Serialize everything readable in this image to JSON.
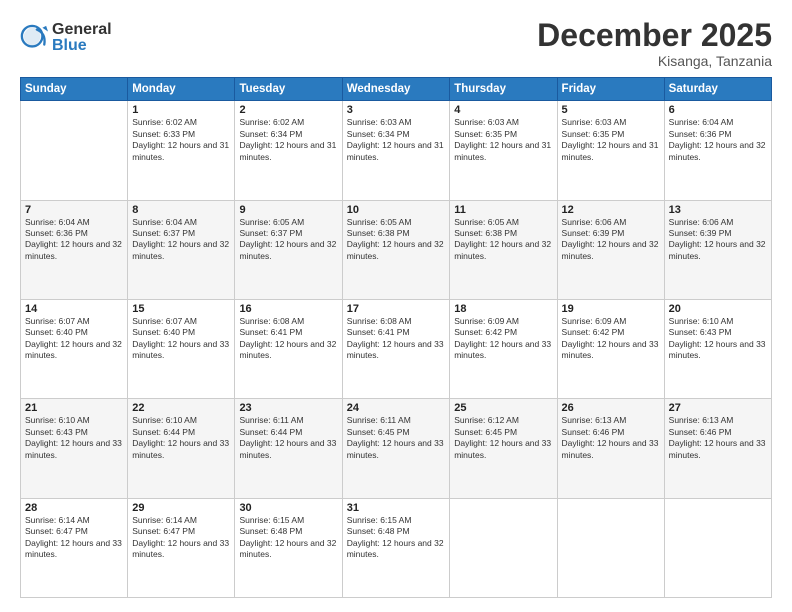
{
  "logo": {
    "general": "General",
    "blue": "Blue"
  },
  "header": {
    "month": "December 2025",
    "location": "Kisanga, Tanzania"
  },
  "days_of_week": [
    "Sunday",
    "Monday",
    "Tuesday",
    "Wednesday",
    "Thursday",
    "Friday",
    "Saturday"
  ],
  "weeks": [
    [
      {
        "day": "",
        "sunrise": "",
        "sunset": "",
        "daylight": ""
      },
      {
        "day": "1",
        "sunrise": "Sunrise: 6:02 AM",
        "sunset": "Sunset: 6:33 PM",
        "daylight": "Daylight: 12 hours and 31 minutes."
      },
      {
        "day": "2",
        "sunrise": "Sunrise: 6:02 AM",
        "sunset": "Sunset: 6:34 PM",
        "daylight": "Daylight: 12 hours and 31 minutes."
      },
      {
        "day": "3",
        "sunrise": "Sunrise: 6:03 AM",
        "sunset": "Sunset: 6:34 PM",
        "daylight": "Daylight: 12 hours and 31 minutes."
      },
      {
        "day": "4",
        "sunrise": "Sunrise: 6:03 AM",
        "sunset": "Sunset: 6:35 PM",
        "daylight": "Daylight: 12 hours and 31 minutes."
      },
      {
        "day": "5",
        "sunrise": "Sunrise: 6:03 AM",
        "sunset": "Sunset: 6:35 PM",
        "daylight": "Daylight: 12 hours and 31 minutes."
      },
      {
        "day": "6",
        "sunrise": "Sunrise: 6:04 AM",
        "sunset": "Sunset: 6:36 PM",
        "daylight": "Daylight: 12 hours and 32 minutes."
      }
    ],
    [
      {
        "day": "7",
        "sunrise": "Sunrise: 6:04 AM",
        "sunset": "Sunset: 6:36 PM",
        "daylight": "Daylight: 12 hours and 32 minutes."
      },
      {
        "day": "8",
        "sunrise": "Sunrise: 6:04 AM",
        "sunset": "Sunset: 6:37 PM",
        "daylight": "Daylight: 12 hours and 32 minutes."
      },
      {
        "day": "9",
        "sunrise": "Sunrise: 6:05 AM",
        "sunset": "Sunset: 6:37 PM",
        "daylight": "Daylight: 12 hours and 32 minutes."
      },
      {
        "day": "10",
        "sunrise": "Sunrise: 6:05 AM",
        "sunset": "Sunset: 6:38 PM",
        "daylight": "Daylight: 12 hours and 32 minutes."
      },
      {
        "day": "11",
        "sunrise": "Sunrise: 6:05 AM",
        "sunset": "Sunset: 6:38 PM",
        "daylight": "Daylight: 12 hours and 32 minutes."
      },
      {
        "day": "12",
        "sunrise": "Sunrise: 6:06 AM",
        "sunset": "Sunset: 6:39 PM",
        "daylight": "Daylight: 12 hours and 32 minutes."
      },
      {
        "day": "13",
        "sunrise": "Sunrise: 6:06 AM",
        "sunset": "Sunset: 6:39 PM",
        "daylight": "Daylight: 12 hours and 32 minutes."
      }
    ],
    [
      {
        "day": "14",
        "sunrise": "Sunrise: 6:07 AM",
        "sunset": "Sunset: 6:40 PM",
        "daylight": "Daylight: 12 hours and 32 minutes."
      },
      {
        "day": "15",
        "sunrise": "Sunrise: 6:07 AM",
        "sunset": "Sunset: 6:40 PM",
        "daylight": "Daylight: 12 hours and 33 minutes."
      },
      {
        "day": "16",
        "sunrise": "Sunrise: 6:08 AM",
        "sunset": "Sunset: 6:41 PM",
        "daylight": "Daylight: 12 hours and 32 minutes."
      },
      {
        "day": "17",
        "sunrise": "Sunrise: 6:08 AM",
        "sunset": "Sunset: 6:41 PM",
        "daylight": "Daylight: 12 hours and 33 minutes."
      },
      {
        "day": "18",
        "sunrise": "Sunrise: 6:09 AM",
        "sunset": "Sunset: 6:42 PM",
        "daylight": "Daylight: 12 hours and 33 minutes."
      },
      {
        "day": "19",
        "sunrise": "Sunrise: 6:09 AM",
        "sunset": "Sunset: 6:42 PM",
        "daylight": "Daylight: 12 hours and 33 minutes."
      },
      {
        "day": "20",
        "sunrise": "Sunrise: 6:10 AM",
        "sunset": "Sunset: 6:43 PM",
        "daylight": "Daylight: 12 hours and 33 minutes."
      }
    ],
    [
      {
        "day": "21",
        "sunrise": "Sunrise: 6:10 AM",
        "sunset": "Sunset: 6:43 PM",
        "daylight": "Daylight: 12 hours and 33 minutes."
      },
      {
        "day": "22",
        "sunrise": "Sunrise: 6:10 AM",
        "sunset": "Sunset: 6:44 PM",
        "daylight": "Daylight: 12 hours and 33 minutes."
      },
      {
        "day": "23",
        "sunrise": "Sunrise: 6:11 AM",
        "sunset": "Sunset: 6:44 PM",
        "daylight": "Daylight: 12 hours and 33 minutes."
      },
      {
        "day": "24",
        "sunrise": "Sunrise: 6:11 AM",
        "sunset": "Sunset: 6:45 PM",
        "daylight": "Daylight: 12 hours and 33 minutes."
      },
      {
        "day": "25",
        "sunrise": "Sunrise: 6:12 AM",
        "sunset": "Sunset: 6:45 PM",
        "daylight": "Daylight: 12 hours and 33 minutes."
      },
      {
        "day": "26",
        "sunrise": "Sunrise: 6:13 AM",
        "sunset": "Sunset: 6:46 PM",
        "daylight": "Daylight: 12 hours and 33 minutes."
      },
      {
        "day": "27",
        "sunrise": "Sunrise: 6:13 AM",
        "sunset": "Sunset: 6:46 PM",
        "daylight": "Daylight: 12 hours and 33 minutes."
      }
    ],
    [
      {
        "day": "28",
        "sunrise": "Sunrise: 6:14 AM",
        "sunset": "Sunset: 6:47 PM",
        "daylight": "Daylight: 12 hours and 33 minutes."
      },
      {
        "day": "29",
        "sunrise": "Sunrise: 6:14 AM",
        "sunset": "Sunset: 6:47 PM",
        "daylight": "Daylight: 12 hours and 33 minutes."
      },
      {
        "day": "30",
        "sunrise": "Sunrise: 6:15 AM",
        "sunset": "Sunset: 6:48 PM",
        "daylight": "Daylight: 12 hours and 32 minutes."
      },
      {
        "day": "31",
        "sunrise": "Sunrise: 6:15 AM",
        "sunset": "Sunset: 6:48 PM",
        "daylight": "Daylight: 12 hours and 32 minutes."
      },
      {
        "day": "",
        "sunrise": "",
        "sunset": "",
        "daylight": ""
      },
      {
        "day": "",
        "sunrise": "",
        "sunset": "",
        "daylight": ""
      },
      {
        "day": "",
        "sunrise": "",
        "sunset": "",
        "daylight": ""
      }
    ]
  ]
}
